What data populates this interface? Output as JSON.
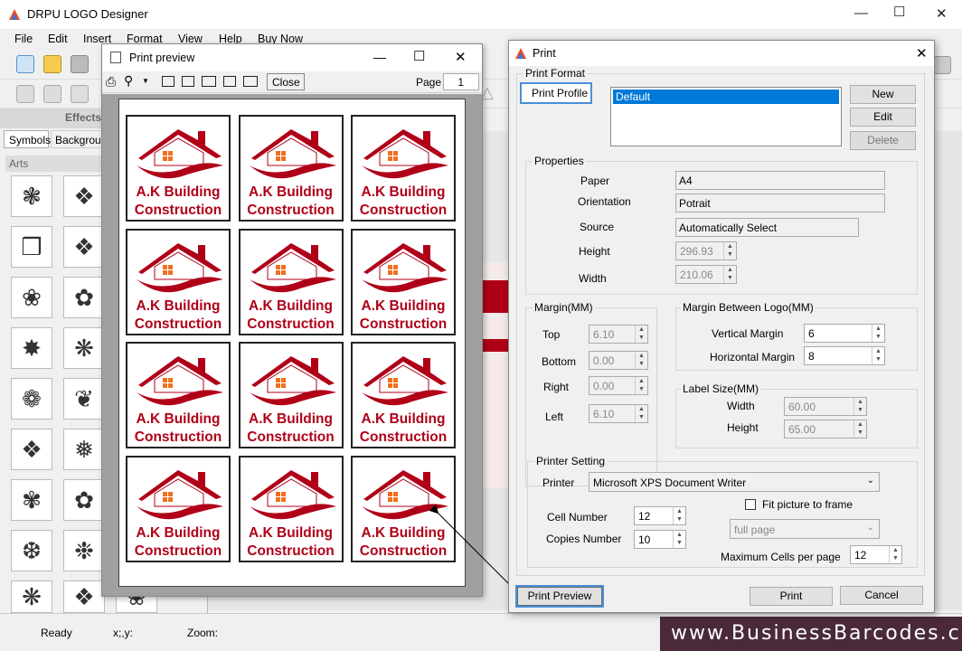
{
  "app": {
    "title": "DRPU LOGO Designer"
  },
  "menu": [
    "File",
    "Edit",
    "Insert",
    "Format",
    "View",
    "Help",
    "Buy Now"
  ],
  "left_panel": {
    "effects_label": "Effects",
    "tabs": [
      "Symbols",
      "Backgrour"
    ],
    "section": "Arts"
  },
  "status": {
    "ready": "Ready",
    "xy": "x;,y:",
    "zoom": "Zoom:"
  },
  "brand": "www.BusinessBarcodes.com",
  "print_preview": {
    "title": "Print preview",
    "close_label": "Close",
    "page_label": "Page",
    "page_value": "1",
    "label_line1": "A.K Building",
    "label_line2": "Construction",
    "label_count": 12
  },
  "print_dialog": {
    "title": "Print",
    "print_format": "Print Format",
    "print_profile": "Print Profile",
    "profiles": [
      "Default"
    ],
    "new": "New",
    "edit": "Edit",
    "delete": "Delete",
    "properties": "Properties",
    "paper_label": "Paper",
    "paper": "A4",
    "orientation_label": "Orientation",
    "orientation": "Potrait",
    "source_label": "Source",
    "source": "Automatically Select",
    "height_label": "Height",
    "height": "296.93",
    "width_label": "Width",
    "width": "210.06",
    "margin_group": "Margin(MM)",
    "top_label": "Top",
    "top": "6.10",
    "bottom_label": "Bottom",
    "bottom": "0.00",
    "right_label": "Right",
    "right": "0.00",
    "left_label": "Left",
    "left": "6.10",
    "between_group": "Margin Between Logo(MM)",
    "vmargin_label": "Vertical Margin",
    "vmargin": "6",
    "hmargin_label": "Horizontal Margin",
    "hmargin": "8",
    "label_size_group": "Label Size(MM)",
    "ls_width_label": "Width",
    "ls_width": "60.00",
    "ls_height_label": "Height",
    "ls_height": "65.00",
    "printer_group": "Printer Setting",
    "printer_label": "Printer",
    "printer": "Microsoft XPS Document Writer",
    "fit_label": "Fit picture to frame",
    "fit_mode": "full page",
    "cell_label": "Cell Number",
    "cell": "12",
    "copies_label": "Copies Number",
    "copies": "10",
    "max_cells_label": "Maximum Cells per page",
    "max_cells": "12",
    "print_preview_btn": "Print Preview",
    "print_btn": "Print",
    "cancel_btn": "Cancel"
  },
  "colors": {
    "brand_red": "#b00018",
    "accent_orange": "#f07020",
    "selection": "#0078d7"
  }
}
